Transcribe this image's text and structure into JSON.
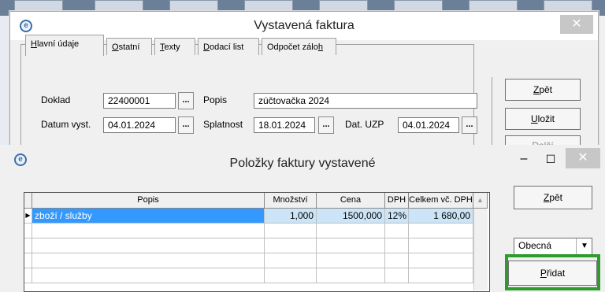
{
  "faktura_window": {
    "title": "Vystavená faktura",
    "close_glyph": "✕",
    "tabs": [
      {
        "pre": "",
        "ul": "H",
        "post": "lavní údaje"
      },
      {
        "pre": "",
        "ul": "O",
        "post": "statní"
      },
      {
        "pre": "",
        "ul": "T",
        "post": "exty"
      },
      {
        "pre": "",
        "ul": "D",
        "post": "odací list"
      },
      {
        "pre": "Odpočet zálo",
        "ul": "h",
        "post": ""
      }
    ],
    "fields": {
      "doklad_label": "Doklad",
      "doklad_value": "22400001",
      "popis_label": "Popis",
      "popis_value": "zúčtovačka 2024",
      "datum_label": "Datum vyst.",
      "datum_value": "04.01.2024",
      "splatnost_label": "Splatnost",
      "splatnost_value": "18.01.2024",
      "uzp_label": "Dat. UZP",
      "uzp_value": "04.01.2024",
      "dots": "..."
    },
    "buttons": {
      "zpet": {
        "ul": "Z",
        "post": "pět"
      },
      "ulozit": {
        "ul": "U",
        "post": "ložit"
      },
      "dalsi": "Další"
    }
  },
  "polozky_window": {
    "title": "Položky faktury vystavené",
    "min_glyph": "–",
    "max_glyph": "☐",
    "close_glyph": "✕",
    "columns": [
      "Popis",
      "Množství",
      "Cena",
      "DPH",
      "Celkem vč. DPH"
    ],
    "rows": [
      {
        "popis": "zboží / služby",
        "mnozstvi": "1,000",
        "cena": "1500,000",
        "dph": "12%",
        "celkem": "1 680,00"
      }
    ],
    "buttons": {
      "zpet": {
        "ul": "Z",
        "post": "pět"
      },
      "pridat": {
        "ul": "P",
        "post": "řidat"
      }
    },
    "combo_value": "Obecná"
  },
  "colors": {
    "selection": "#3399ff",
    "highlight_border": "#2e9b2e"
  }
}
